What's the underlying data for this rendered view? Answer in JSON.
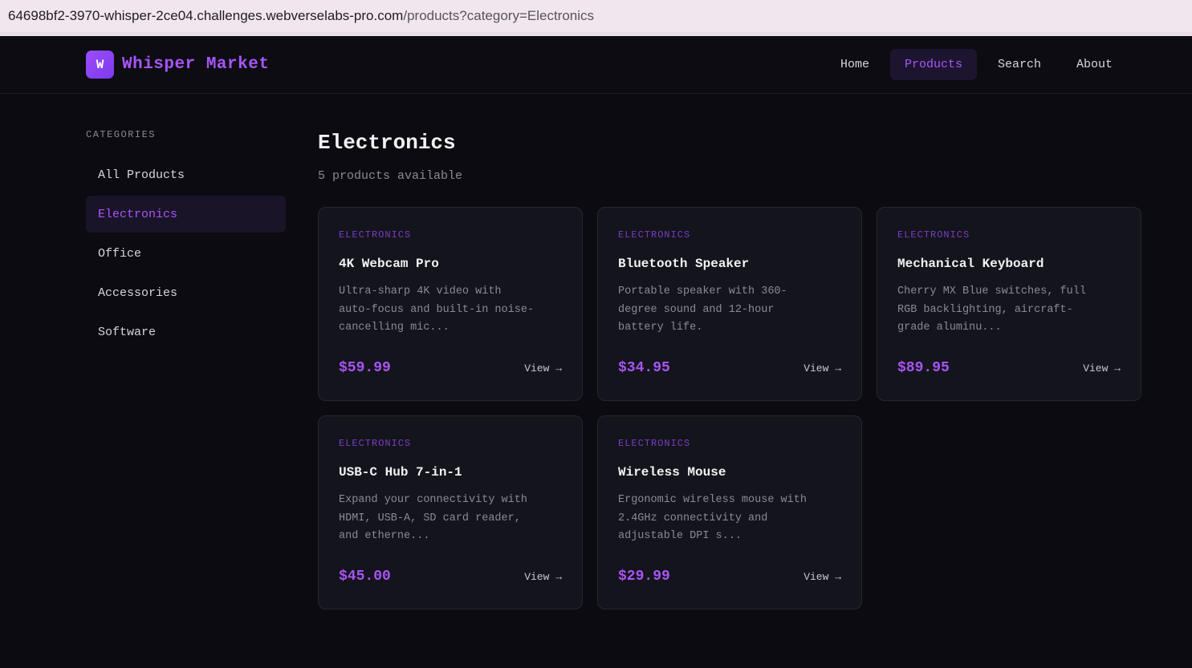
{
  "browser": {
    "url_host": "64698bf2-3970-whisper-2ce04.challenges.webverselabs-pro.com",
    "url_path": "/products?category=Electronics"
  },
  "header": {
    "logo_letter": "W",
    "brand": "Whisper Market",
    "nav": [
      {
        "label": "Home",
        "active": false
      },
      {
        "label": "Products",
        "active": true
      },
      {
        "label": "Search",
        "active": false
      },
      {
        "label": "About",
        "active": false
      }
    ]
  },
  "sidebar": {
    "heading": "CATEGORIES",
    "items": [
      {
        "label": "All Products",
        "active": false
      },
      {
        "label": "Electronics",
        "active": true
      },
      {
        "label": "Office",
        "active": false
      },
      {
        "label": "Accessories",
        "active": false
      },
      {
        "label": "Software",
        "active": false
      }
    ]
  },
  "main": {
    "title": "Electronics",
    "subtitle": "5 products available",
    "products": [
      {
        "category": "ELECTRONICS",
        "name": "4K Webcam Pro",
        "desc_lines": [
          "Ultra-sharp 4K video with",
          "auto-focus and built-in noise-",
          "cancelling mic..."
        ],
        "price": "$59.99",
        "view": "View →"
      },
      {
        "category": "ELECTRONICS",
        "name": "Bluetooth Speaker",
        "desc_lines": [
          "Portable speaker with 360-",
          "degree sound and 12-hour",
          "battery life."
        ],
        "price": "$34.95",
        "view": "View →"
      },
      {
        "category": "ELECTRONICS",
        "name": "Mechanical Keyboard",
        "desc_lines": [
          "Cherry MX Blue switches, full",
          "RGB backlighting, aircraft-",
          "grade aluminu..."
        ],
        "price": "$89.95",
        "view": "View →"
      },
      {
        "category": "ELECTRONICS",
        "name": "USB-C Hub 7-in-1",
        "desc_lines": [
          "Expand your connectivity with",
          "HDMI, USB-A, SD card reader,",
          "and etherne..."
        ],
        "price": "$45.00",
        "view": "View →"
      },
      {
        "category": "ELECTRONICS",
        "name": "Wireless Mouse",
        "desc_lines": [
          "Ergonomic wireless mouse with",
          "2.4GHz connectivity and",
          "adjustable DPI s..."
        ],
        "price": "$29.99",
        "view": "View →"
      }
    ]
  },
  "colors": {
    "accent": "#a855f7",
    "background": "#0b0b11",
    "card": "#14141c"
  }
}
